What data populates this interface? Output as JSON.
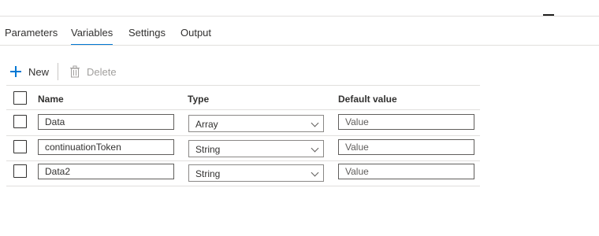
{
  "tabs": [
    {
      "label": "Parameters",
      "active": false
    },
    {
      "label": "Variables",
      "active": true
    },
    {
      "label": "Settings",
      "active": false
    },
    {
      "label": "Output",
      "active": false
    }
  ],
  "toolbar": {
    "new_label": "New",
    "delete_label": "Delete"
  },
  "table": {
    "headers": {
      "name": "Name",
      "type": "Type",
      "default": "Default value"
    },
    "default_placeholder": "Value",
    "rows": [
      {
        "name": "Data",
        "type": "Array"
      },
      {
        "name": "continuationToken",
        "type": "String"
      },
      {
        "name": "Data2",
        "type": "String"
      }
    ]
  },
  "colors": {
    "accent": "#0078d4",
    "disabled": "#a19f9d",
    "border": "#e1dfdd"
  }
}
